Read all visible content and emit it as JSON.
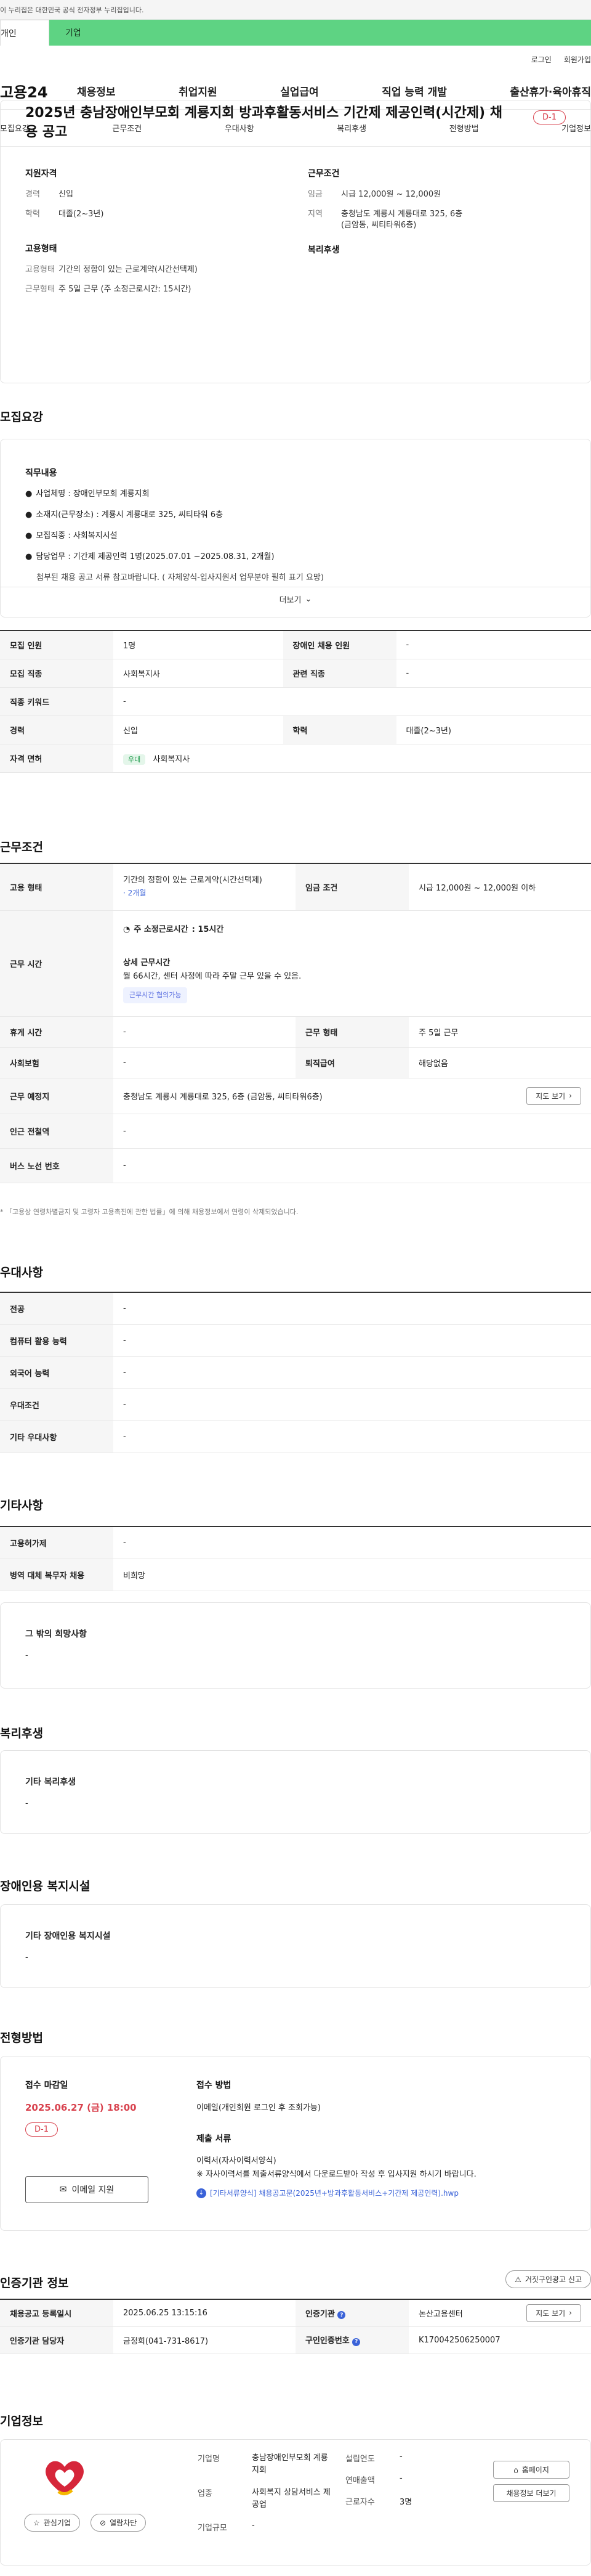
{
  "gov_bar": "이 누리집은 대한민국 공식 전자정부 누리집입니다.",
  "tabs": {
    "personal": "개인",
    "company": "기업"
  },
  "util": {
    "login": "로그인",
    "signup": "회원가입"
  },
  "gnb": {
    "logo": "고용24",
    "menus": [
      "채용정보",
      "취업지원",
      "실업급여",
      "직업 능력 개발",
      "출산휴가·육아휴직"
    ]
  },
  "snb": [
    "모집요강",
    "근무조건",
    "우대사항",
    "복리후생",
    "전형방법",
    "기업정보"
  ],
  "header": {
    "title": "2025년 충남장애인부모회 계룡지회 방과후활동서비스 기간제 제공인력(시간제) 채용 공고",
    "dday": "D-1",
    "qual_h": "지원자격",
    "qual": [
      {
        "k": "경력",
        "v": "신입"
      },
      {
        "k": "학력",
        "v": "대졸(2~3년)"
      }
    ],
    "cond_h": "근무조건",
    "cond": [
      {
        "k": "임금",
        "v": "시급 12,000원 ~ 12,000원"
      },
      {
        "k": "지역",
        "v": "충청남도 계룡시 계룡대로 325, 6층 (금암동, 씨티타워6층)"
      }
    ],
    "emp_h": "고용형태",
    "emp": [
      {
        "k": "고용형태",
        "v": "기간의 정함이 있는 근로계약(시간선택제)"
      },
      {
        "k": "근무형태",
        "v": "주 5일 근무 (주 소정근로시간: 15시간)"
      }
    ],
    "welfare_h": "복리후생"
  },
  "recruit": {
    "title": "모집요강",
    "duty_h": "직무내용",
    "duties": [
      "사업체명 : 장애인부모회 계룡지회",
      "소재지(근무장소) : 계룡시 계룡대로 325, 씨티타워 6층",
      "모집직종 : 사회복지시설",
      "담당업무 : 기간제 제공인력 1명(2025.07.01 ~2025.08.31, 2개월)"
    ],
    "cut_text": "첨부된 채용 공고 서류 참고바랍니다. ( 자체양식-입사지원서 업무분야 필히 표기 요망)",
    "more": "더보기",
    "rows": [
      {
        "k1": "모집 인원",
        "v1": "1명",
        "k2": "장애인 채용 인원",
        "v2": "-"
      },
      {
        "k1": "모집 직종",
        "v1": "사회복지사",
        "k2": "관련 직종",
        "v2": "-"
      },
      {
        "k1": "직종 키워드",
        "v1": "-"
      },
      {
        "k1": "경력",
        "v1": "신입",
        "k2": "학력",
        "v2": "대졸(2~3년)"
      }
    ],
    "license_k": "자격 면허",
    "license_badge": "우대",
    "license_v": "사회복지사"
  },
  "work": {
    "title": "근무조건",
    "emp_k": "고용 형태",
    "emp_v": "기간의 정함이 있는 근로계약(시간선택제)",
    "emp_sub": "· 2개월",
    "wage_k": "임금 조건",
    "wage_v": "시급 12,000원 ~ 12,000원 이하",
    "time_k": "근무 시간",
    "hours_label": "주 소정근로시간",
    "hours_v": ": 15시간",
    "detail_h": "상세 근무시간",
    "detail_v": "월 66시간, 센터 사정에 따라 주말 근무 있을 수 있음.",
    "detail_tag": "근무시간 협의가능",
    "rows": [
      {
        "k1": "휴게 시간",
        "v1": "-",
        "k2": "근무 형태",
        "v2": "주 5일 근무"
      },
      {
        "k1": "사회보험",
        "v1": "-",
        "k2": "퇴직급여",
        "v2": "해당없음"
      }
    ],
    "place_k": "근무 예정지",
    "place_v": "충청남도 계룡시 계룡대로 325, 6층 (금암동, 씨티타워6층)",
    "map_btn": "지도 보기",
    "station_k": "인근 전철역",
    "station_v": "-",
    "bus_k": "버스 노선 번호",
    "bus_v": "-",
    "note": "* 「고용상 연령차별금지 및 고령자 고용촉진에 관한 법률」에 의해 채용정보에서 연령이 삭제되었습니다."
  },
  "pref": {
    "title": "우대사항",
    "rows": [
      {
        "k": "전공",
        "v": "-"
      },
      {
        "k": "컴퓨터 활용 능력",
        "v": "-"
      },
      {
        "k": "외국어 능력",
        "v": "-"
      },
      {
        "k": "우대조건",
        "v": "-"
      },
      {
        "k": "기타 우대사항",
        "v": "-"
      }
    ]
  },
  "etc": {
    "title": "기타사항",
    "rows": [
      {
        "k": "고용허가제",
        "v": "-"
      },
      {
        "k": "병역 대체 복무자 채용",
        "v": "비희망"
      }
    ],
    "box_h": "그 밖의 희망사항",
    "box_v": "-"
  },
  "welfare": {
    "title": "복리후생",
    "box_h": "기타 복리후생",
    "box_v": "-"
  },
  "disabled": {
    "title": "장애인용 복지시설",
    "box_h": "기타 장애인용 복지시설",
    "box_v": "-"
  },
  "select": {
    "title": "전형방법",
    "deadline_h": "접수 마감일",
    "deadline_v": "2025.06.27 (금) 18:00",
    "dday": "D-1",
    "email_btn": "이메일 지원",
    "method_h": "접수 방법",
    "method_v": "이메일(개인회원 로그인 후 조회가능)",
    "docs_h": "제출 서류",
    "docs_1": "이력서(자사이력서양식)",
    "docs_2": "※ 자사이력서를 제출서류양식에서 다운로드받아 작성 후 입사지원 하시기 바랍니다.",
    "file": "[기타서류양식] 채용공고문(2025년+방과후활동서비스+기간제 제공인력).hwp"
  },
  "cert": {
    "title": "인증기관 정보",
    "report_btn": "거짓구인광고 신고",
    "rows": [
      {
        "k1": "채용공고 등록일시",
        "v1": "2025.06.25 13:15:16",
        "k2": "인증기관",
        "v2": "논산고용센터",
        "btn": "지도 보기"
      },
      {
        "k1": "인증기관 담당자",
        "v1": "금정희(041-731-8617)",
        "k2": "구인인증번호",
        "v2": "K170042506250007"
      }
    ]
  },
  "company": {
    "title": "기업정보",
    "fav_btn": "관심기업",
    "block_btn": "열람차단",
    "name_k": "기업명",
    "name_v": "충남장애인부모회 계룡지회",
    "ind_k": "업종",
    "ind_v": "사회복지 상담서비스 제공업",
    "size_k": "기업규모",
    "size_v": "-",
    "est_k": "설립연도",
    "est_v": "-",
    "sales_k": "연매출액",
    "sales_v": "-",
    "emp_k": "근로자수",
    "emp_v": "3명",
    "home_btn": "홈페이지",
    "info_btn": "채용정보 더보기"
  },
  "colors": {
    "accent_green": "#5ed383",
    "dday_red": "#d8414d",
    "link_blue": "#3a62d8"
  }
}
